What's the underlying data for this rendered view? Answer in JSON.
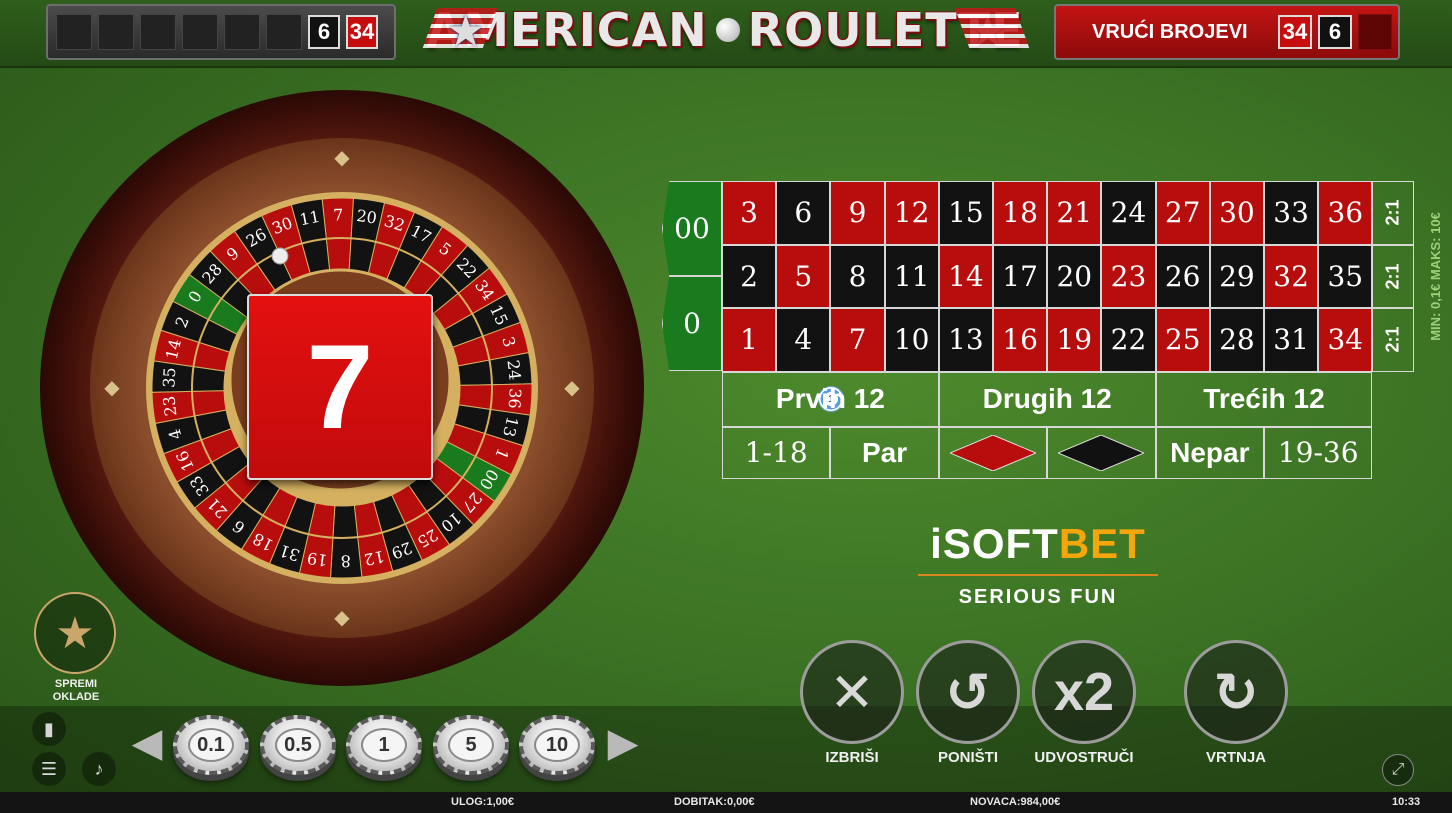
{
  "header": {
    "history_numbers": [
      {
        "value": "6",
        "color": "black"
      },
      {
        "value": "34",
        "color": "red"
      }
    ],
    "title_left": "AMERICAN",
    "title_right": "ROULETTE",
    "hot_label": "VRUĆI BROJEVI",
    "hot_numbers": [
      {
        "value": "34",
        "color": "red"
      },
      {
        "value": "6",
        "color": "black"
      }
    ]
  },
  "wheel": {
    "result": "7",
    "result_color": "red",
    "pockets": [
      "7",
      "20",
      "32",
      "17",
      "5",
      "22",
      "34",
      "15",
      "3",
      "24",
      "36",
      "13",
      "1",
      "00",
      "27",
      "10",
      "25",
      "29",
      "12",
      "8",
      "19",
      "31",
      "18",
      "6",
      "21",
      "33",
      "16",
      "4",
      "23",
      "35",
      "14",
      "2",
      "0",
      "28",
      "9",
      "26",
      "30",
      "11"
    ],
    "pocket_colors": {
      "0": "green",
      "00": "green",
      "1": "red",
      "3": "red",
      "5": "red",
      "7": "red",
      "9": "red",
      "12": "red",
      "14": "red",
      "16": "red",
      "18": "red",
      "19": "red",
      "21": "red",
      "23": "red",
      "25": "red",
      "27": "red",
      "30": "red",
      "32": "red",
      "34": "red",
      "36": "red"
    }
  },
  "table": {
    "zero_labels": [
      "00",
      "0"
    ],
    "rows": [
      [
        "3",
        "6",
        "9",
        "12",
        "15",
        "18",
        "21",
        "24",
        "27",
        "30",
        "33",
        "36"
      ],
      [
        "2",
        "5",
        "8",
        "11",
        "14",
        "17",
        "20",
        "23",
        "26",
        "29",
        "32",
        "35"
      ],
      [
        "1",
        "4",
        "7",
        "10",
        "13",
        "16",
        "19",
        "22",
        "25",
        "28",
        "31",
        "34"
      ]
    ],
    "column_bet": "2:1",
    "dozens": [
      "Prvih 12",
      "Drugih 12",
      "Trećih 12"
    ],
    "outside": [
      "1-18",
      "Par",
      "Nepar",
      "19-36"
    ],
    "min_max": "MIN: 0,1€   MAKS: 10€",
    "placed_bet_chip": "1"
  },
  "logo": {
    "brand_i": "i",
    "brand_soft": "SOFT",
    "brand_bet": "BET",
    "tagline": "SERIOUS FUN"
  },
  "controls": {
    "favourites_label_1": "SPREMI",
    "favourites_label_2": "OKLADE",
    "chips": [
      "0.1",
      "0.5",
      "1",
      "5",
      "10"
    ],
    "actions": {
      "clear": "IZBRIŠI",
      "undo": "PONIŠTI",
      "double": "UDVOSTRUČI",
      "double_icon": "x2",
      "spin": "VRTNJA"
    }
  },
  "status": {
    "bet_label": "ULOG:",
    "bet_value": "1,00€",
    "win_label": "DOBITAK:",
    "win_value": "0,00€",
    "balance_label": "NOVACA:",
    "balance_value": "984,00€",
    "clock": "10:33"
  },
  "colors": {
    "felt": "#3c7424",
    "red": "#b80d0d",
    "black": "#121212",
    "green": "#1a7a1e",
    "brand_orange": "#f5a60c"
  }
}
